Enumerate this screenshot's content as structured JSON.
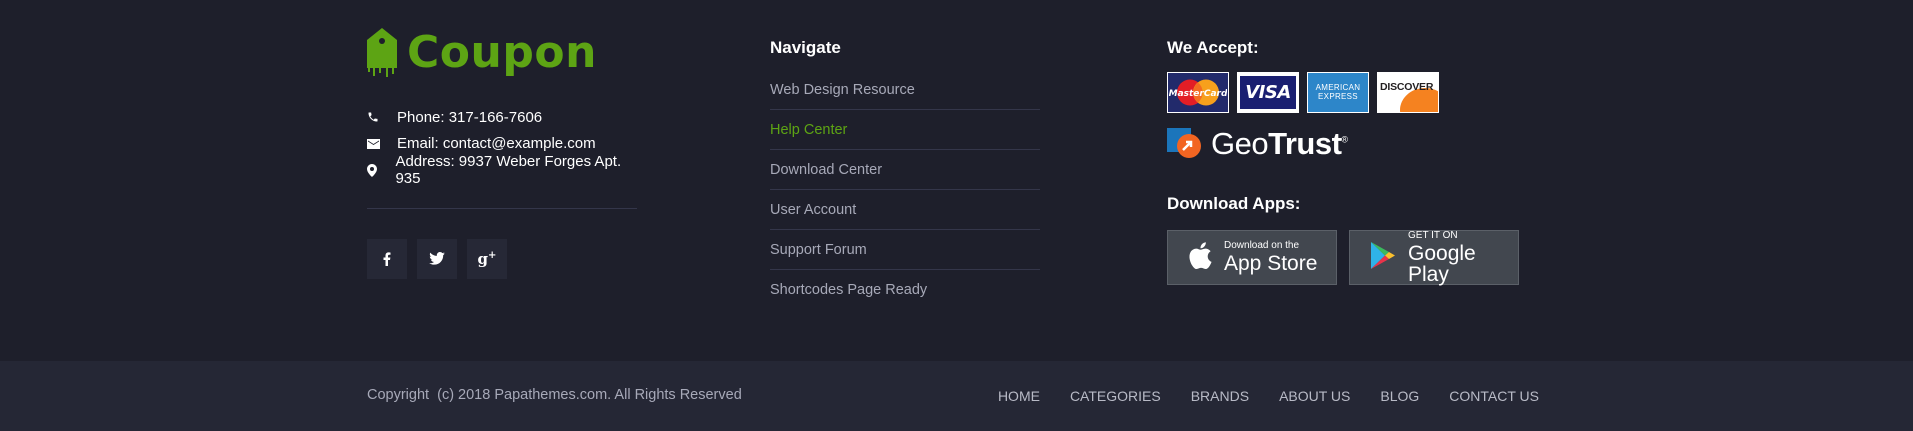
{
  "brand": {
    "name": "Coupon",
    "color": "#5da414",
    "icon": "tag-logo-icon"
  },
  "contact": [
    {
      "icon": "phone-icon",
      "text": "Phone: 317-166-7606"
    },
    {
      "icon": "email-icon",
      "text": "Email: contact@example.com"
    },
    {
      "icon": "location-pin-icon",
      "text": "Address: 9937 Weber Forges Apt. 935"
    }
  ],
  "social": [
    {
      "icon": "facebook-icon",
      "glyph": "f"
    },
    {
      "icon": "twitter-icon",
      "glyph": "t"
    },
    {
      "icon": "google-plus-icon",
      "glyph": "g+"
    }
  ],
  "navigate": {
    "title": "Navigate",
    "items": [
      {
        "label": "Web Design Resource",
        "active": false
      },
      {
        "label": "Help Center",
        "active": true
      },
      {
        "label": "Download Center",
        "active": false
      },
      {
        "label": "User Account",
        "active": false
      },
      {
        "label": "Support Forum",
        "active": false
      },
      {
        "label": "Shortcodes Page Ready",
        "active": false
      }
    ]
  },
  "payments": {
    "title": "We Accept:",
    "cards": [
      "MasterCard",
      "VISA",
      "AMERICAN EXPRESS",
      "DISCOVER"
    ],
    "secure_badge": "GeoTrust"
  },
  "apps": {
    "title": "Download Apps:",
    "app_store": {
      "small": "Download on the",
      "big": "App Store"
    },
    "google_play": {
      "small": "GET IT ON",
      "big": "Google Play"
    }
  },
  "bottom": {
    "copyright": "Copyright  (c) 2018 Papathemes.com. All Rights Reserved",
    "nav": [
      "HOME",
      "CATEGORIES",
      "BRANDS",
      "ABOUT US",
      "BLOG",
      "CONTACT US"
    ]
  }
}
